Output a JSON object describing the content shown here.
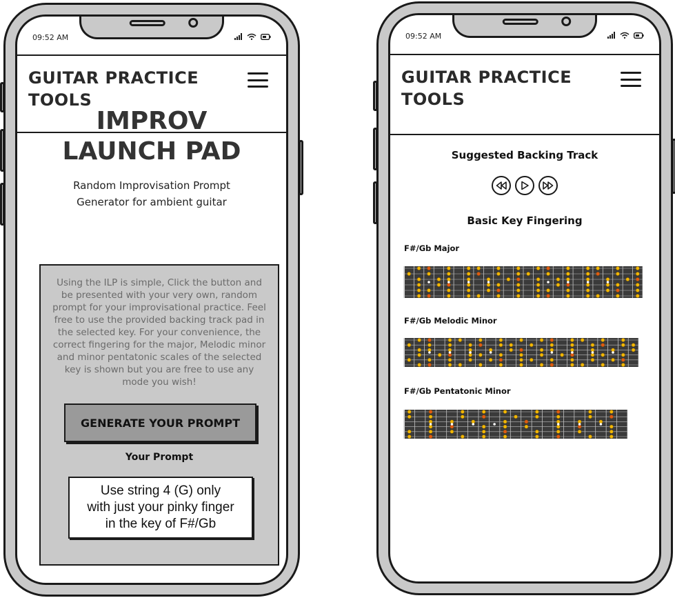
{
  "status": {
    "time": "09:52 AM"
  },
  "header": {
    "brand_line1": "GUITAR PRACTICE",
    "brand_line2": "TOOLS"
  },
  "screen1": {
    "title_line1": "IMPROV",
    "title_line2": "LAUNCH PAD",
    "subtitle_line1": "Random Improvisation Prompt",
    "subtitle_line2": "Generator for ambient guitar",
    "description": "Using the ILP is simple, Click the button and be presented with your very own, random prompt for your improvisational practice. Feel free to use the provided backing track pad in the selected key. For your convenience, the correct fingering for the major, Melodic minor and minor pentatonic scales of the selected key is shown but you are free to use any mode you wish!",
    "generate_button": "GENERATE YOUR PROMPT",
    "prompt_label": "Your Prompt",
    "prompt_line1": "Use string 4 (G) only",
    "prompt_line2": "with just your pinky finger",
    "prompt_line3": "in the key of F#/Gb"
  },
  "screen2": {
    "backing_track_title": "Suggested Backing Track",
    "fingering_title": "Basic Key Fingering",
    "scales": [
      {
        "name": "F#/Gb Major"
      },
      {
        "name": "F#/Gb Melodic Minor"
      },
      {
        "name": "F#/Gb Pentatonic Minor"
      }
    ]
  },
  "colors": {
    "frame": "#c9c9c9",
    "outline": "#1a1a1a",
    "card": "#c9c9c9",
    "button": "#9a9a9a",
    "fretboard": "#3a3a3a",
    "note": "#f2b705",
    "root": "#e05a12"
  },
  "icons": [
    "menu-icon",
    "signal-icon",
    "wifi-icon",
    "battery-icon",
    "rewind-icon",
    "play-icon",
    "fast-forward-icon"
  ]
}
